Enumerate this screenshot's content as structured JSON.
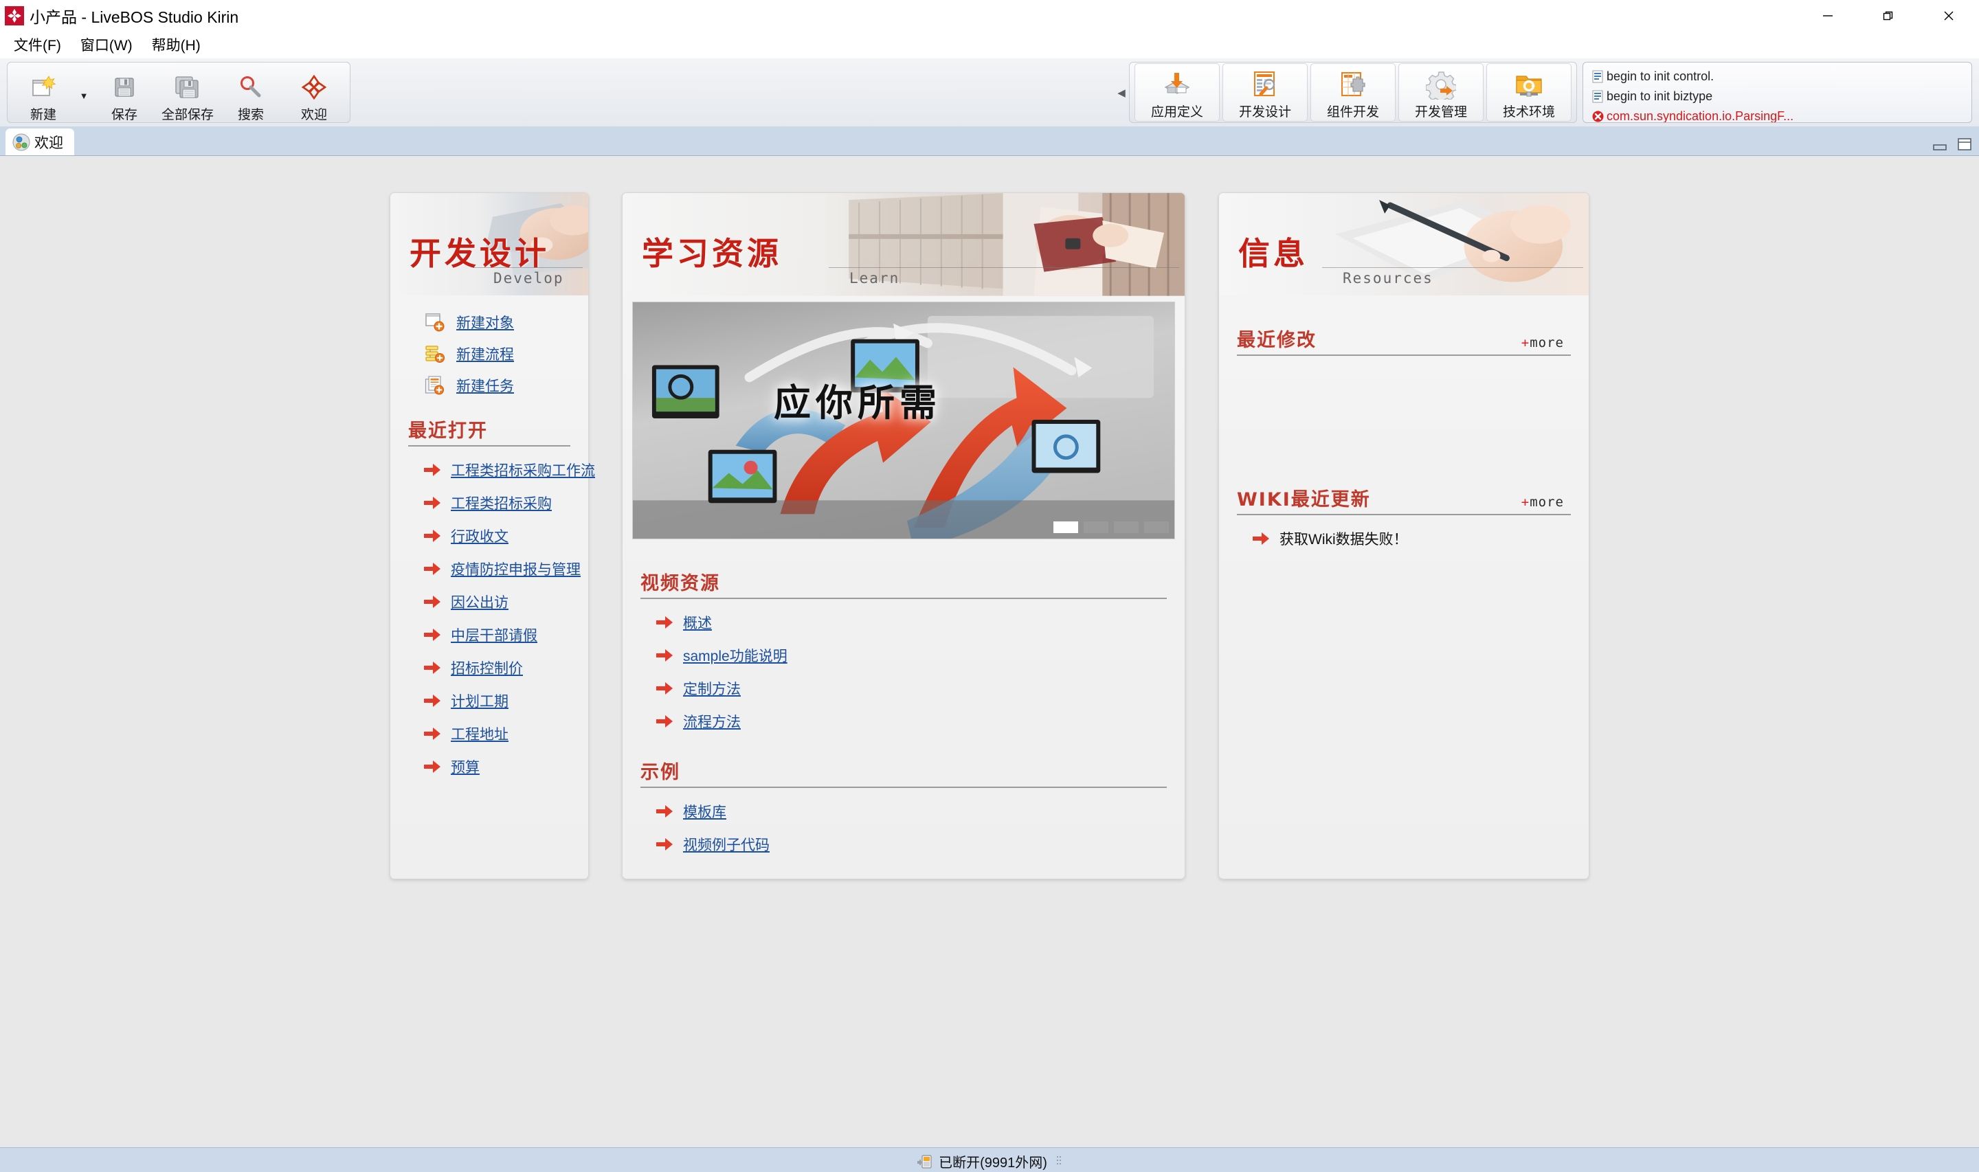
{
  "window": {
    "title": "小产品 - LiveBOS Studio Kirin",
    "logo_icon": "livebos-flower-icon",
    "controls": {
      "minimize": "—",
      "restore": "❐",
      "close": "✕"
    }
  },
  "menubar": {
    "items": [
      {
        "label": "文件(F)",
        "name": "menu-file"
      },
      {
        "label": "窗口(W)",
        "name": "menu-window"
      },
      {
        "label": "帮助(H)",
        "name": "menu-help"
      }
    ]
  },
  "toolbar": {
    "left_buttons": [
      {
        "label": "新建",
        "icon": "new-document-icon",
        "has_dropdown": true
      },
      {
        "label": "保存",
        "icon": "save-floppy-icon",
        "has_dropdown": false
      },
      {
        "label": "全部保存",
        "icon": "save-all-floppy-icon",
        "has_dropdown": false
      },
      {
        "label": "搜索",
        "icon": "magnifier-icon",
        "has_dropdown": false
      },
      {
        "label": "欢迎",
        "icon": "welcome-flower-icon",
        "has_dropdown": false
      }
    ],
    "collapse_icon": "collapse-left-arrow-icon",
    "right_buttons": [
      {
        "label": "应用定义",
        "icon": "app-definition-icon"
      },
      {
        "label": "开发设计",
        "icon": "develop-design-icon"
      },
      {
        "label": "组件开发",
        "icon": "component-develop-icon"
      },
      {
        "label": "开发管理",
        "icon": "develop-manage-gear-icon"
      },
      {
        "label": "技术环境",
        "icon": "tech-environment-folder-icon"
      }
    ]
  },
  "log_panel": {
    "lines": [
      {
        "text": "begin to init control.",
        "icon": "log-info-icon",
        "level": "info"
      },
      {
        "text": "begin to init biztype",
        "icon": "log-info-icon",
        "level": "info"
      },
      {
        "text": "com.sun.syndication.io.ParsingF...",
        "icon": "log-error-icon",
        "level": "error"
      }
    ]
  },
  "tabbar": {
    "tabs": [
      {
        "label": "欢迎",
        "icon": "welcome-tab-icon",
        "active": true
      }
    ],
    "controls": {
      "minimize": "minimize-view-icon",
      "maximize": "maximize-view-icon"
    }
  },
  "cards": {
    "develop": {
      "title_zh": "开发设计",
      "title_en": "Develop",
      "banner_icon": "hands-on-keyboard-photo",
      "quick_links": [
        {
          "label": "新建对象",
          "icon": "new-object-icon"
        },
        {
          "label": "新建流程",
          "icon": "new-flow-icon"
        },
        {
          "label": "新建任务",
          "icon": "new-task-icon"
        }
      ],
      "recent_section": {
        "title": "最近打开",
        "items": [
          "工程类招标采购工作流",
          "工程类招标采购",
          "行政收文",
          "疫情防控申报与管理",
          "因公出访",
          "中层干部请假",
          "招标控制价",
          "计划工期",
          "工程地址",
          "预算"
        ]
      }
    },
    "learn": {
      "title_zh": "学习资源",
      "title_en": "Learn",
      "banner_icon": "library-books-photo",
      "hero": {
        "text": "应你所需",
        "icon": "arrows-monitors-promo-image",
        "dots": 4,
        "active_dot": 1
      },
      "video_section": {
        "title": "视频资源",
        "items": [
          "概述",
          "sample功能说明",
          "定制方法",
          "流程方法"
        ]
      },
      "example_section": {
        "title": "示例",
        "items": [
          "模板库",
          "视频例子代码"
        ]
      }
    },
    "resources": {
      "title_zh": "信息",
      "title_en": "Resources",
      "banner_icon": "hand-writing-pen-photo",
      "recent_modified": {
        "title": "最近修改",
        "more_label": "more",
        "more_plus": "+",
        "items": []
      },
      "wiki_updates": {
        "title": "WIKI最近更新",
        "more_label": "more",
        "more_plus": "+",
        "items": [
          {
            "text": "获取Wiki数据失败！",
            "is_link": false
          }
        ]
      }
    }
  },
  "statusbar": {
    "icon": "disconnected-network-icon",
    "text": "已断开(9991外网)",
    "grip_icon": "resize-grip-icon"
  },
  "colors": {
    "accent_red": "#c81e13",
    "link_blue": "#1b4fa0",
    "heading_red": "#c0392b",
    "tab_bar": "#cbd8e8",
    "content_bg": "#e8e8e8",
    "error_red": "#d81818"
  }
}
